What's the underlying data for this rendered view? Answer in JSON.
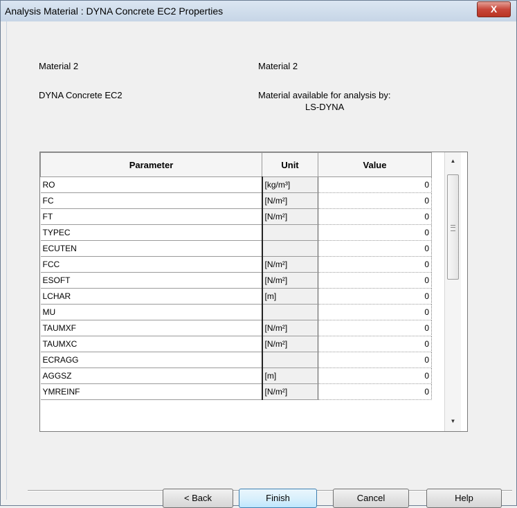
{
  "window": {
    "title": "Analysis Material : DYNA Concrete EC2 Properties",
    "close_glyph": "X"
  },
  "info": {
    "material_label": "Material   2",
    "material_name": "Material 2",
    "material_type": "DYNA Concrete EC2",
    "available_label": "Material available for analysis by:",
    "available_program": "LS-DYNA"
  },
  "grid": {
    "headers": {
      "parameter": "Parameter",
      "unit": "Unit",
      "value": "Value"
    },
    "rows": [
      {
        "param": "RO",
        "unit": "[kg/m³]",
        "value": "0"
      },
      {
        "param": "FC",
        "unit": "[N/m²]",
        "value": "0"
      },
      {
        "param": "FT",
        "unit": "[N/m²]",
        "value": "0"
      },
      {
        "param": "TYPEC",
        "unit": "",
        "value": "0"
      },
      {
        "param": "ECUTEN",
        "unit": "",
        "value": "0"
      },
      {
        "param": "FCC",
        "unit": "[N/m²]",
        "value": "0"
      },
      {
        "param": "ESOFT",
        "unit": "[N/m²]",
        "value": "0"
      },
      {
        "param": "LCHAR",
        "unit": "[m]",
        "value": "0"
      },
      {
        "param": "MU",
        "unit": "",
        "value": "0"
      },
      {
        "param": "TAUMXF",
        "unit": "[N/m²]",
        "value": "0"
      },
      {
        "param": "TAUMXC",
        "unit": "[N/m²]",
        "value": "0"
      },
      {
        "param": "ECRAGG",
        "unit": "",
        "value": "0"
      },
      {
        "param": "AGGSZ",
        "unit": "[m]",
        "value": "0"
      },
      {
        "param": "YMREINF",
        "unit": "[N/m²]",
        "value": "0"
      }
    ]
  },
  "buttons": {
    "back": "< Back",
    "finish": "Finish",
    "cancel": "Cancel",
    "help": "Help"
  }
}
